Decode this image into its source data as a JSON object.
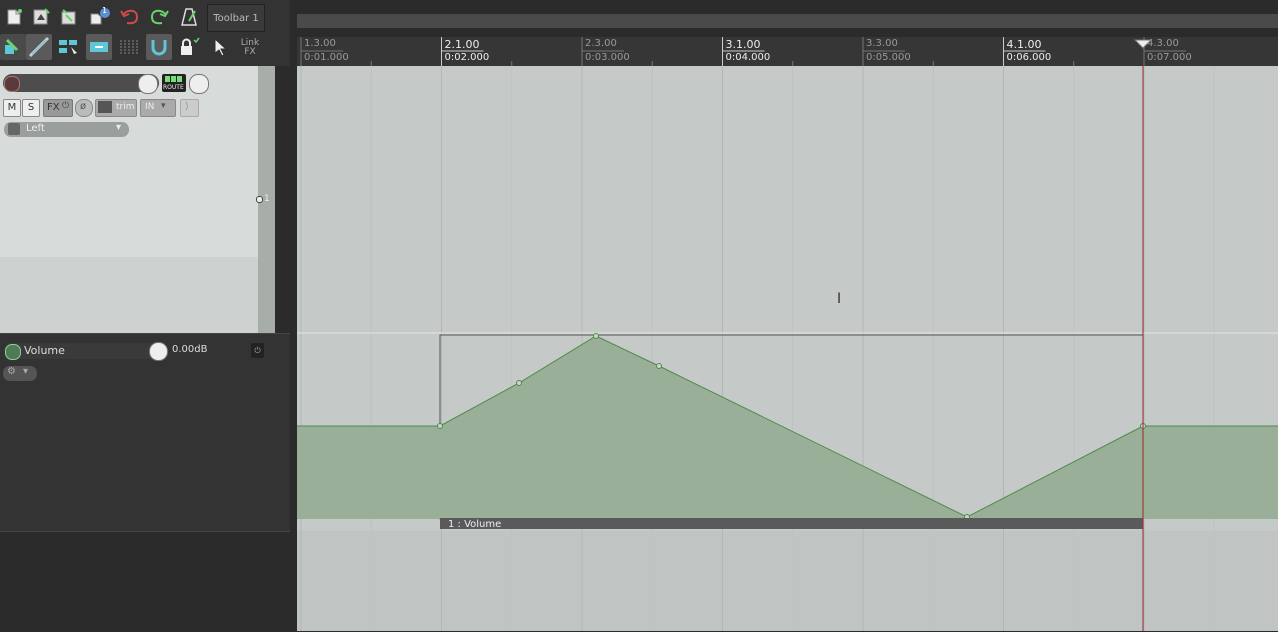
{
  "toolbar": {
    "label": "Toolbar 1",
    "link_fx": [
      "Link",
      "FX"
    ],
    "badge": "1"
  },
  "track": {
    "route_label": "ROUTE",
    "mute": "M",
    "solo": "S",
    "fx": "FX",
    "trim": "trim",
    "input": "IN",
    "input_channel": "Left",
    "number": "1"
  },
  "envelope": {
    "name": "Volume",
    "value": "0.00dB",
    "lane_label": "1 : Volume"
  },
  "ruler": {
    "marks": [
      {
        "measure": "1.3.00",
        "time": "0:01.000",
        "major": false
      },
      {
        "measure": "2.1.00",
        "time": "0:02.000",
        "major": true
      },
      {
        "measure": "2.3.00",
        "time": "0:03.000",
        "major": false
      },
      {
        "measure": "3.1.00",
        "time": "0:04.000",
        "major": true
      },
      {
        "measure": "3.3.00",
        "time": "0:05.000",
        "major": false
      },
      {
        "measure": "4.1.00",
        "time": "0:06.000",
        "major": true
      },
      {
        "measure": "4.3.00",
        "time": "0:07.000",
        "major": false
      }
    ]
  },
  "colors": {
    "envelope_fill": "#9aaf98",
    "envelope_line": "#4f8a4c",
    "cursor": "#9a2a2a"
  }
}
